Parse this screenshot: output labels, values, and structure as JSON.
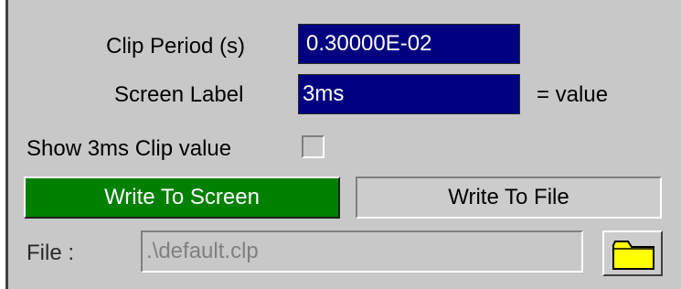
{
  "clip_period": {
    "label": "Clip Period (s)",
    "value": "0.30000E-02"
  },
  "screen_label": {
    "label": "Screen Label",
    "value": "3ms",
    "suffix": "= value"
  },
  "show_clip": {
    "label": "Show 3ms Clip value",
    "checked": false
  },
  "buttons": {
    "write_screen": "Write To Screen",
    "write_file": "Write To File"
  },
  "file": {
    "label": "File :",
    "value": ".\\default.clp",
    "icon": "folder-icon"
  },
  "colors": {
    "panel_bg": "#c8c8c8",
    "field_bg": "#000080",
    "active_button": "#008000",
    "folder": "#ffff00"
  }
}
